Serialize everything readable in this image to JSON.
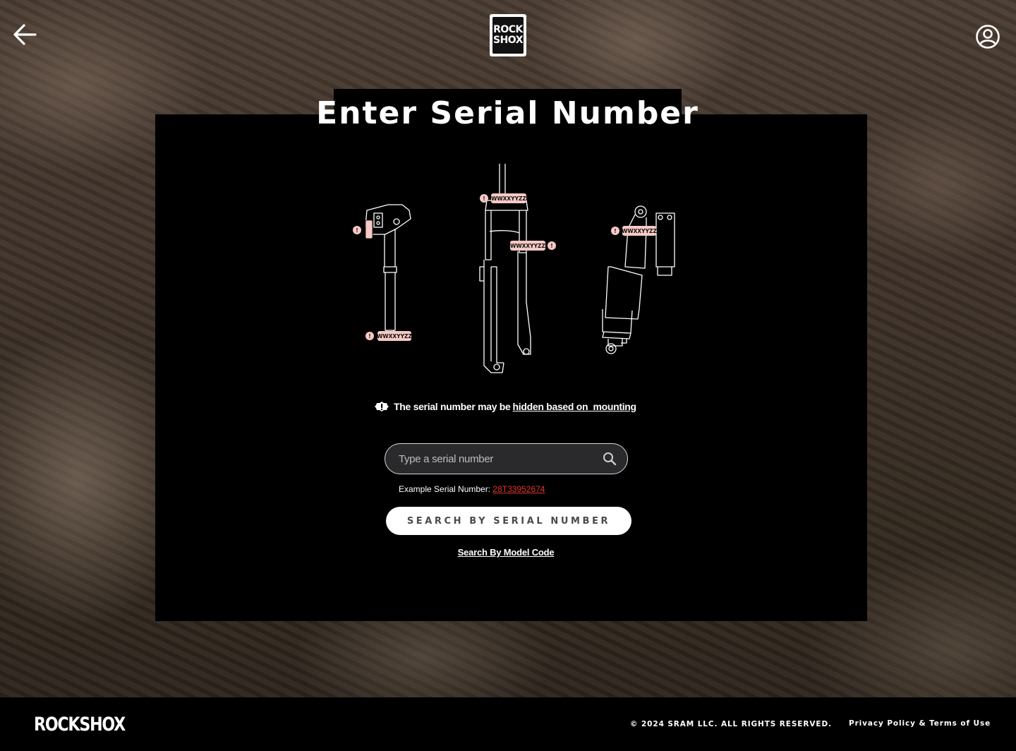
{
  "header": {
    "back_icon": "arrow-left-icon",
    "logo_line1": "ROCK",
    "logo_line2": "SHOX",
    "account_icon": "user-circle-icon"
  },
  "main": {
    "title": "Enter Serial Number",
    "serial_tag": "WWXXYYZZ",
    "hint_text": "The serial number may be ",
    "hint_link": "hidden based on  mounting",
    "search_placeholder": "Type a serial number",
    "search_value": "",
    "example_label": "Example Serial Number: ",
    "example_value": "28T33952674",
    "primary_button": "SEARCH BY SERIAL NUMBER",
    "secondary_link": "Search By Model Code"
  },
  "footer": {
    "logo": "ROCKSHOX",
    "copyright": "© 2024 SRAM LLC. ALL RIGHTS RESERVED.",
    "legal_link": "Privacy Policy & Terms of Use"
  },
  "colors": {
    "accent_link": "#e3352b",
    "tag_fill": "#f6c9c4",
    "panel": "#000000"
  }
}
